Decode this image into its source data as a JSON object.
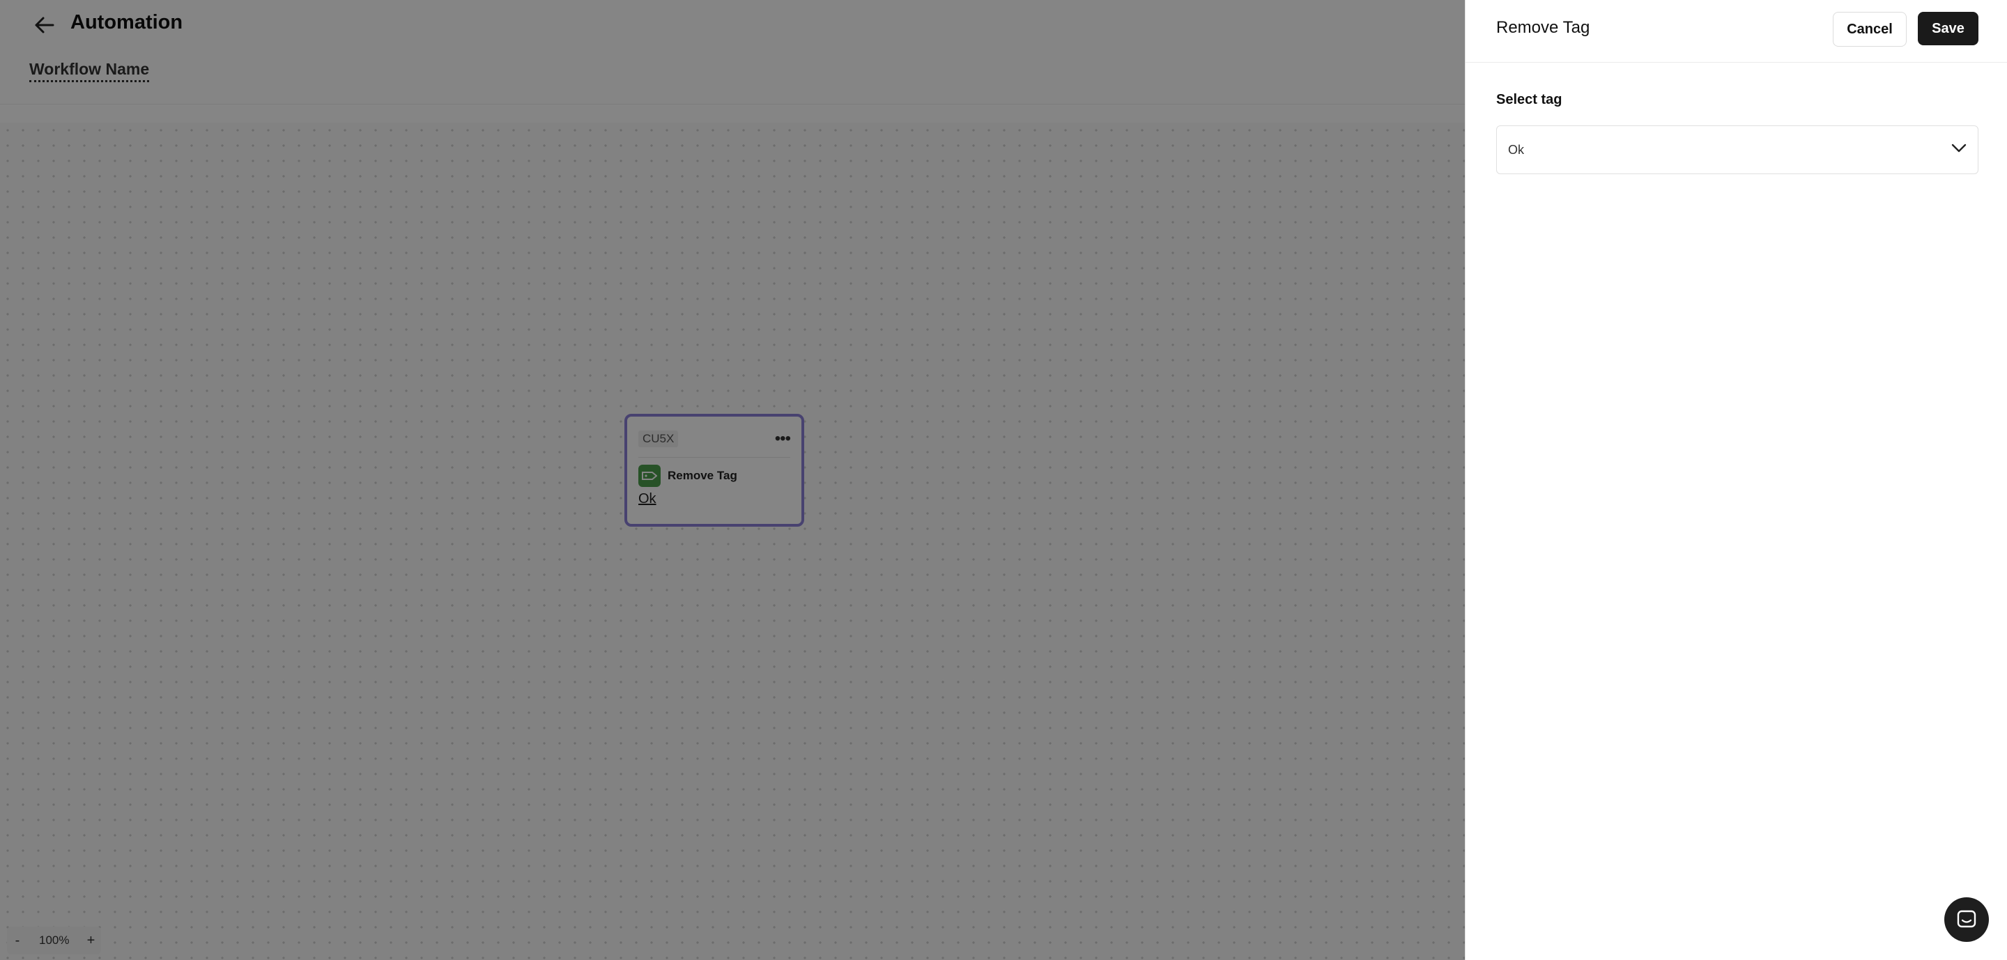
{
  "header": {
    "title": "Automation",
    "workflow_name": "Workflow Name"
  },
  "node": {
    "id": "CU5X",
    "action": "Remove Tag",
    "value": "Ok",
    "icon": "tag-icon"
  },
  "zoom": {
    "minus": "-",
    "level": "100%",
    "plus": "+"
  },
  "drawer": {
    "title": "Remove Tag",
    "cancel_label": "Cancel",
    "save_label": "Save",
    "field_label": "Select tag",
    "selected_tag": "Ok"
  },
  "colors": {
    "accent": "#8b7fd6",
    "tag_icon": "#4b9e4b",
    "primary_button": "#1a1a1a"
  }
}
